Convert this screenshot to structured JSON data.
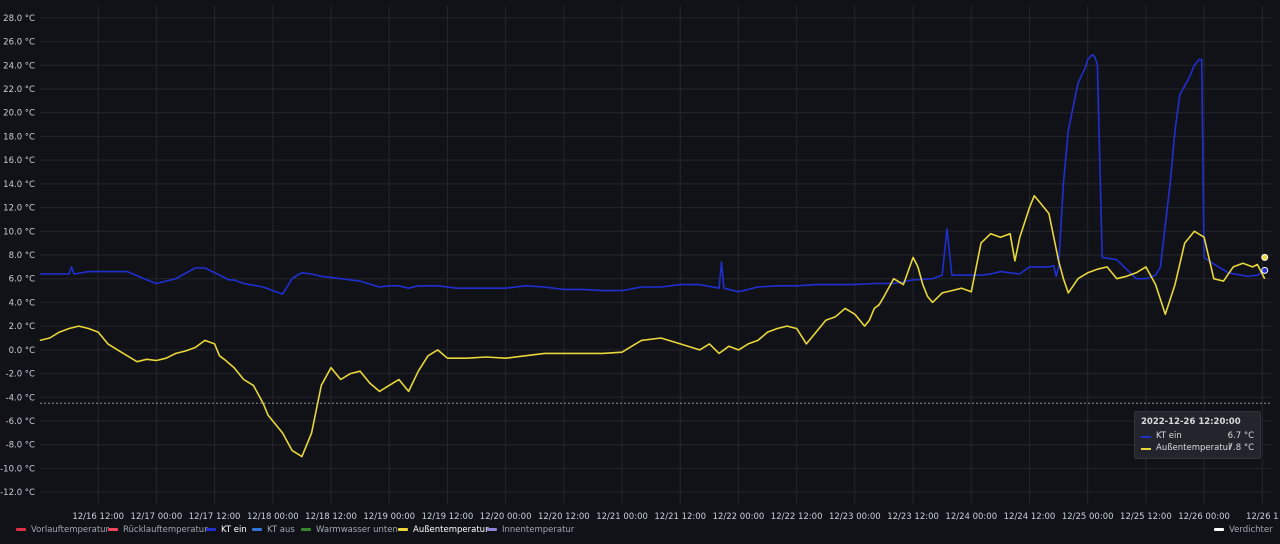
{
  "chart_data": {
    "type": "line",
    "ylim": [
      -13,
      29
    ],
    "y_ticks": [
      -12,
      -10,
      -8,
      -6,
      -4,
      -2,
      0,
      2,
      4,
      6,
      8,
      10,
      12,
      14,
      16,
      18,
      20,
      22,
      24,
      26,
      28
    ],
    "y_unit": "°C",
    "x_range": [
      "2022-12-16 00:00",
      "2022-12-26 13:00"
    ],
    "x_ticks": [
      "12/16 12:00",
      "12/17 00:00",
      "12/17 12:00",
      "12/18 00:00",
      "12/18 12:00",
      "12/19 00:00",
      "12/19 12:00",
      "12/20 00:00",
      "12/20 12:00",
      "12/21 00:00",
      "12/21 12:00",
      "12/22 00:00",
      "12/22 12:00",
      "12/23 00:00",
      "12/23 12:00",
      "12/24 00:00",
      "12/24 12:00",
      "12/25 00:00",
      "12/25 12:00",
      "12/26 00:00",
      "12/26 1"
    ],
    "x_tick_hours": [
      12,
      24,
      36,
      48,
      60,
      72,
      84,
      96,
      108,
      120,
      132,
      144,
      156,
      168,
      180,
      192,
      204,
      216,
      228,
      240,
      252
    ],
    "threshold_line": -4.5,
    "grid": true,
    "series": [
      {
        "name": "KT ein",
        "color": "#1f2fd0",
        "x_hours": [
          0,
          6,
          6.5,
          7,
          10,
          18,
          22,
          24,
          28,
          32,
          34,
          38,
          39,
          40,
          42,
          46,
          50,
          52,
          53,
          54,
          56,
          58,
          62,
          64,
          66,
          70,
          72,
          74,
          76,
          78,
          82,
          86,
          90,
          94,
          96,
          100,
          104,
          108,
          112,
          116,
          120,
          124,
          128,
          132,
          136,
          140,
          140.5,
          141,
          144,
          148,
          152,
          156,
          160,
          164,
          168,
          172,
          176,
          180,
          184,
          186,
          187,
          188,
          190,
          194,
          196,
          198,
          200,
          202,
          204,
          208,
          209,
          209.5,
          210,
          211,
          212,
          213.5,
          214,
          215.5,
          216,
          217,
          217.5,
          218,
          219,
          222,
          226,
          228,
          230,
          231,
          233,
          234,
          235,
          237,
          238,
          239,
          239.5,
          240,
          241,
          245,
          249,
          251,
          252.5
        ],
        "values": [
          6.4,
          6.4,
          7.0,
          6.4,
          6.6,
          6.6,
          5.9,
          5.6,
          6.0,
          6.9,
          6.9,
          6.1,
          5.9,
          5.9,
          5.6,
          5.3,
          4.7,
          6.0,
          6.3,
          6.5,
          6.4,
          6.2,
          6.0,
          5.9,
          5.8,
          5.3,
          5.4,
          5.4,
          5.2,
          5.4,
          5.4,
          5.2,
          5.2,
          5.2,
          5.2,
          5.4,
          5.3,
          5.1,
          5.1,
          5.0,
          5.0,
          5.3,
          5.3,
          5.5,
          5.5,
          5.2,
          7.4,
          5.2,
          4.9,
          5.3,
          5.4,
          5.4,
          5.5,
          5.5,
          5.5,
          5.6,
          5.6,
          5.9,
          6.0,
          6.3,
          10.2,
          6.3,
          6.3,
          6.3,
          6.4,
          6.6,
          6.5,
          6.4,
          7.0,
          7.0,
          7.1,
          6.2,
          7.0,
          14.0,
          18.5,
          21.5,
          22.5,
          23.8,
          24.5,
          24.9,
          24.7,
          24.0,
          7.8,
          7.6,
          6.0,
          6.0,
          6.3,
          7.0,
          14.0,
          18.5,
          21.5,
          23.0,
          24.0,
          24.5,
          24.5,
          7.8,
          7.5,
          6.5,
          6.2,
          6.3,
          6.7
        ]
      },
      {
        "name": "Außentemperatur",
        "color": "#e8d63b",
        "x_hours": [
          0,
          2,
          4,
          6,
          8,
          10,
          12,
          14,
          16,
          18,
          20,
          22,
          24,
          26,
          28,
          30,
          32,
          34,
          36,
          37,
          38,
          40,
          42,
          44,
          46,
          47,
          48,
          50,
          52,
          54,
          56,
          58,
          60,
          61,
          62,
          64,
          66,
          68,
          70,
          72,
          74,
          76,
          78,
          80,
          82,
          84,
          88,
          92,
          96,
          100,
          104,
          108,
          112,
          116,
          120,
          124,
          128,
          132,
          136,
          138,
          140,
          142,
          144,
          146,
          148,
          150,
          152,
          154,
          156,
          158,
          160,
          162,
          164,
          166,
          168,
          170,
          171,
          172,
          173,
          174,
          176,
          178,
          180,
          181,
          182,
          183,
          184,
          186,
          188,
          190,
          192,
          194,
          196,
          198,
          200,
          201,
          202,
          204,
          205,
          206,
          208,
          210,
          211,
          212,
          214,
          216,
          218,
          220,
          222,
          224,
          226,
          228,
          230,
          232,
          234,
          236,
          238,
          240,
          242,
          244,
          246,
          248,
          250,
          251,
          252.5
        ],
        "values": [
          0.8,
          1.0,
          1.5,
          1.8,
          2.0,
          1.8,
          1.5,
          0.5,
          0,
          -0.5,
          -1.0,
          -0.8,
          -0.9,
          -0.7,
          -0.3,
          -0.1,
          0.2,
          0.8,
          0.5,
          -0.5,
          -0.8,
          -1.5,
          -2.5,
          -3.0,
          -4.5,
          -5.5,
          -6.0,
          -7.0,
          -8.5,
          -9.0,
          -7.0,
          -3.0,
          -1.5,
          -2.0,
          -2.5,
          -2.0,
          -1.8,
          -2.8,
          -3.5,
          -3.0,
          -2.5,
          -3.5,
          -1.8,
          -0.5,
          0,
          -0.7,
          -0.7,
          -0.6,
          -0.7,
          -0.5,
          -0.3,
          -0.3,
          -0.3,
          -0.3,
          -0.2,
          0.8,
          1.0,
          0.5,
          0,
          0.5,
          -0.3,
          0.3,
          0,
          0.5,
          0.8,
          1.5,
          1.8,
          2.0,
          1.8,
          0.5,
          1.5,
          2.5,
          2.8,
          3.5,
          3.0,
          2.0,
          2.5,
          3.5,
          3.8,
          4.5,
          6.0,
          5.5,
          7.8,
          7.0,
          5.5,
          4.5,
          4.0,
          4.8,
          5.0,
          5.2,
          4.9,
          9.0,
          9.8,
          9.5,
          9.8,
          7.5,
          9.5,
          12.0,
          13.0,
          12.5,
          11.5,
          7.5,
          6.0,
          4.8,
          6.0,
          6.5,
          6.8,
          7.0,
          6.0,
          6.2,
          6.5,
          7.0,
          5.5,
          3.0,
          5.5,
          9.0,
          10.0,
          9.5,
          6.0,
          5.8,
          7.0,
          7.3,
          7.0,
          7.2,
          6.0,
          6.5,
          7.0,
          7.5,
          7.8
        ]
      }
    ]
  },
  "tooltip": {
    "time": "2022-12-26 12:20:00",
    "rows": [
      {
        "name": "KT ein",
        "value": "6.7 °C",
        "color": "#1f2fd0"
      },
      {
        "name": "Außentemperatur",
        "value": "7.8 °C",
        "color": "#e8d63b"
      }
    ]
  },
  "legend": [
    {
      "label": "Vorlauftemperatur",
      "color": "#e02f44"
    },
    {
      "label": "Rücklauftemperatur",
      "color": "#f2495c"
    },
    {
      "label": "KT ein",
      "color": "#1f2fd0"
    },
    {
      "label": "KT aus",
      "color": "#3274d9"
    },
    {
      "label": "Warmwasser unten",
      "color": "#37872d"
    },
    {
      "label": "Außentemperatur",
      "color": "#e8d63b"
    },
    {
      "label": "Innentemperatur",
      "color": "#8f81d8"
    }
  ],
  "legend_right": {
    "label": "Verdichter",
    "color": "#ffffff"
  }
}
